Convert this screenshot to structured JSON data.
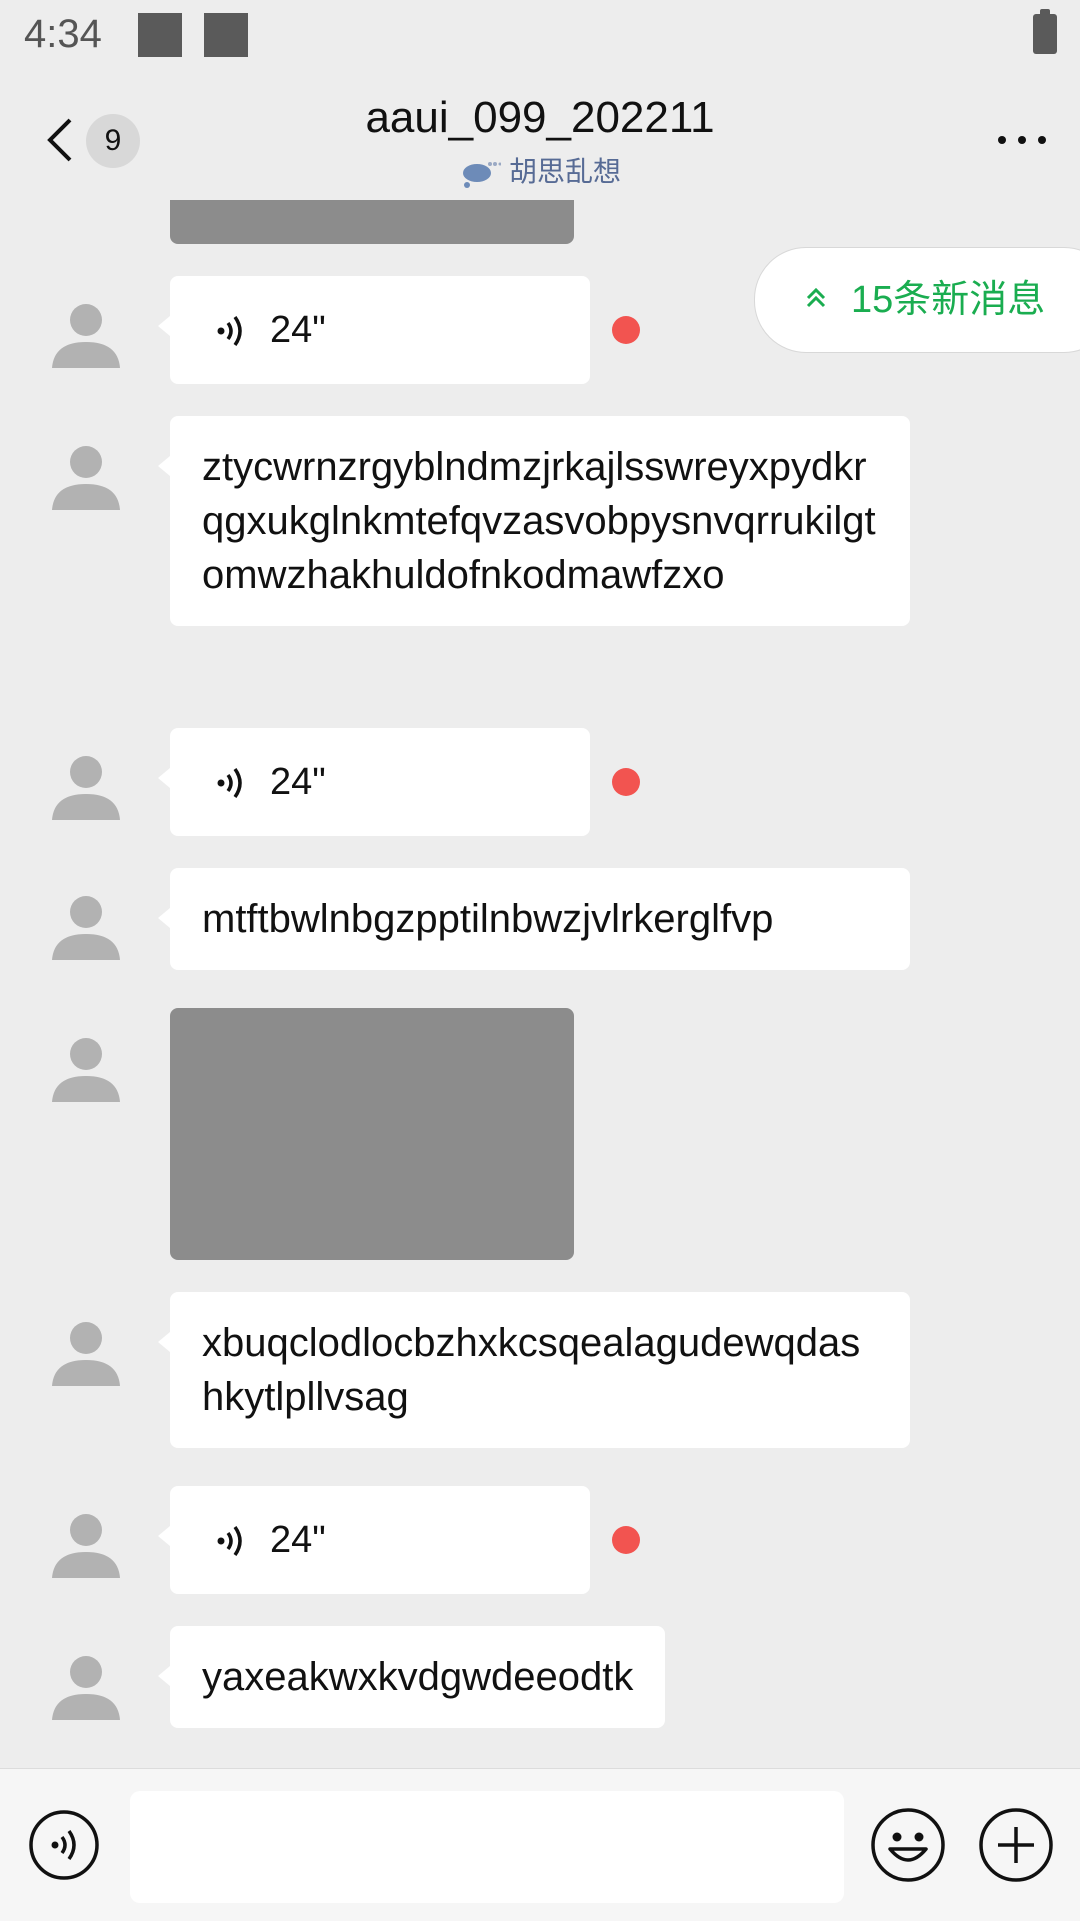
{
  "status_bar": {
    "time": "4:34"
  },
  "header": {
    "unread_count": "9",
    "title": "aaui_099_202211",
    "status_text": "胡思乱想"
  },
  "new_messages_button": {
    "label": "15条新消息"
  },
  "messages": [
    {
      "type": "image"
    },
    {
      "type": "voice",
      "duration": "24\"",
      "unread": true
    },
    {
      "type": "text",
      "text": "ztycwrnzrgyblndmzjrkajlsswreyxpydkrqgxukglnkmtefqvzasvobpysnvqrrukilgtomwzhakhuldofnkodmawfzxo"
    },
    {
      "type": "voice",
      "duration": "24\"",
      "unread": true
    },
    {
      "type": "text",
      "text": "mtftbwlnbgzpptilnbwzjvlrkerglfvp"
    },
    {
      "type": "image"
    },
    {
      "type": "text",
      "text": "xbuqclodlocbzhxkcsqealagudewqdashkytlpllvsag"
    },
    {
      "type": "voice",
      "duration": "24\"",
      "unread": true
    },
    {
      "type": "text",
      "text": "yaxeakwxkvdgwdeeodtk"
    }
  ],
  "colors": {
    "background": "#ededed",
    "accent_green": "#1aad50",
    "unread_dot": "#f25450",
    "status_link": "#576b95"
  },
  "icons": [
    "back-arrow-icon",
    "more-icon",
    "thought-bubble-icon",
    "voice-icon",
    "double-chevron-up-icon",
    "emoji-icon",
    "plus-icon"
  ]
}
